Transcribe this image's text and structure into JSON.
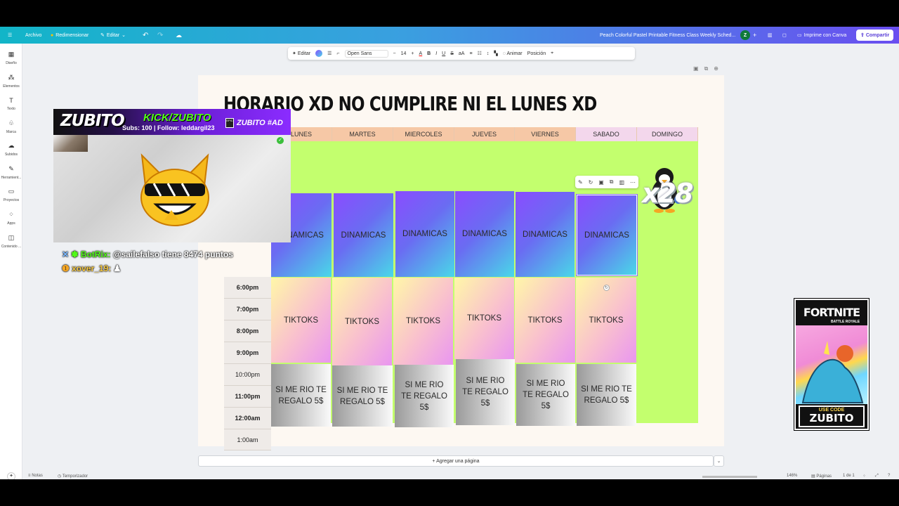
{
  "topbar": {
    "menu_file": "Archivo",
    "resize": "Redimensionar",
    "edit": "Editar",
    "doc_title": "Peach Colorful Pastel Printable Fitness Class Weekly Sched...",
    "avatar_initial": "Z",
    "print_label": "Imprime con Canva",
    "share_label": "Compartir"
  },
  "rail": [
    "Diseño",
    "Elementos",
    "Texto",
    "Marca",
    "Subidos",
    "Herramient...",
    "Proyectos",
    "Apps",
    "Contenido ..."
  ],
  "toolbar": {
    "edit": "Editar",
    "font": "Open Sans",
    "font_size": "14",
    "animate": "Animar",
    "position": "Posición"
  },
  "schedule": {
    "title": "HORARIO XD NO CUMPLIRE NI EL LUNES XD",
    "days": [
      "LUNES",
      "MARTES",
      "MIERCOLES",
      "JUEVES",
      "VIERNES",
      "SABADO",
      "DOMINGO"
    ],
    "times": [
      "6:00pm",
      "7:00pm",
      "8:00pm",
      "9:00pm",
      "10:00pm",
      "11:00pm",
      "12:00am",
      "1:00am"
    ],
    "row1": "DINAMICAS",
    "row2": "TIKTOKS",
    "row3": "SI ME RIO TE REGALO 5$"
  },
  "add_page": "+ Agregar una página",
  "bottom": {
    "notes": "Notas",
    "timer": "Temporizador",
    "zoom": "146%",
    "pages": "Páginas",
    "page_of": "1 de 1"
  },
  "overlay": {
    "logo": "ZUBITO",
    "kick": "KICK/ZUBITO",
    "subs": "Subs: 100 | Follow: leddargil23",
    "code": "ZUBITO #AD",
    "multiplier": "x28",
    "chat1_user": "BotRix:",
    "chat1_text": "@sailefalso tiene 8474 puntos",
    "chat2_user": "xover_19:",
    "fortnite": "FORTNITE",
    "fortnite_sub": "BATTLE ROYALE",
    "use_code": "USE CODE",
    "code_name": "ZUBITO"
  }
}
